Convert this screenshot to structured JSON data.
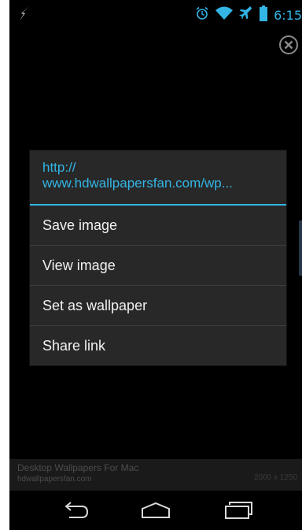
{
  "status_bar": {
    "time": "6:15",
    "icons": [
      "charging-icon",
      "alarm-icon",
      "wifi-icon",
      "airplane-icon",
      "battery-icon"
    ],
    "accent_color": "#33b5e5"
  },
  "context_menu": {
    "title": "http://\nwww.hdwallpapersfan.com/wp...",
    "items": [
      {
        "label": "Save image"
      },
      {
        "label": "View image"
      },
      {
        "label": "Set as wallpaper"
      },
      {
        "label": "Share link"
      }
    ]
  },
  "image_info": {
    "title": "Desktop Wallpapers For Mac",
    "site": "hdwallpapersfan.com",
    "dimensions": "2000 x 1250"
  },
  "nav_bar": {
    "icons": [
      "back-icon",
      "home-icon",
      "recent-apps-icon"
    ]
  }
}
